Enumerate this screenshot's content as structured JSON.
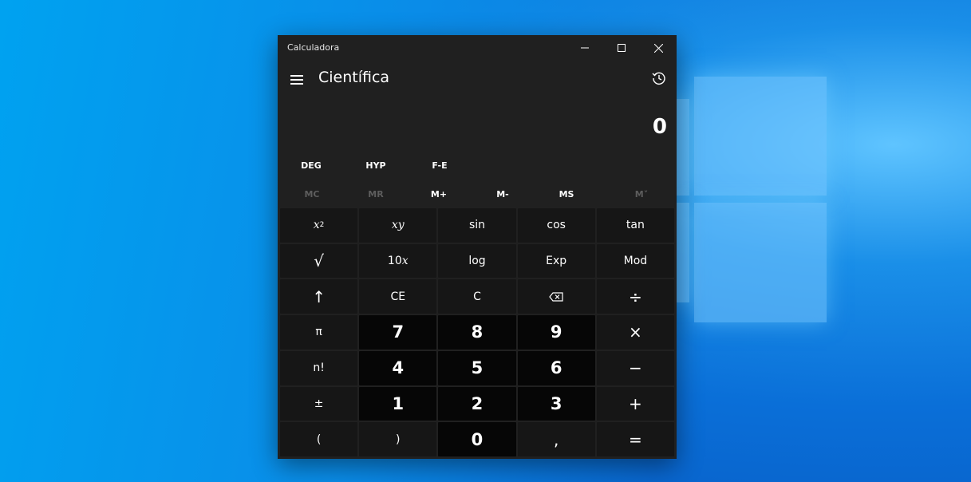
{
  "window": {
    "title": "Calculadora"
  },
  "header": {
    "mode": "Científica"
  },
  "display": {
    "value": "0"
  },
  "toggles": {
    "deg": "DEG",
    "hyp": "HYP",
    "fe": "F-E"
  },
  "memory": {
    "mc": "MC",
    "mr": "MR",
    "mplus": "M+",
    "mminus": "M-",
    "ms": "MS",
    "mlist": "M˅"
  },
  "keys": {
    "x2_base": "x",
    "x2_exp": "2",
    "xy_base": "x",
    "xy_exp": "y",
    "sin": "sin",
    "cos": "cos",
    "tan": "tan",
    "sqrt": "√",
    "pow10_base": "10",
    "pow10_exp": "x",
    "log": "log",
    "exp": "Exp",
    "mod": "Mod",
    "shift": "↑",
    "ce": "CE",
    "c": "C",
    "divide": "÷",
    "pi": "π",
    "seven": "7",
    "eight": "8",
    "nine": "9",
    "multiply": "×",
    "fact": "n!",
    "four": "4",
    "five": "5",
    "six": "6",
    "minus": "−",
    "negate": "±",
    "one": "1",
    "two": "2",
    "three": "3",
    "plus": "+",
    "lparen": "(",
    "rparen": ")",
    "zero": "0",
    "decimal": ",",
    "equals": "="
  }
}
